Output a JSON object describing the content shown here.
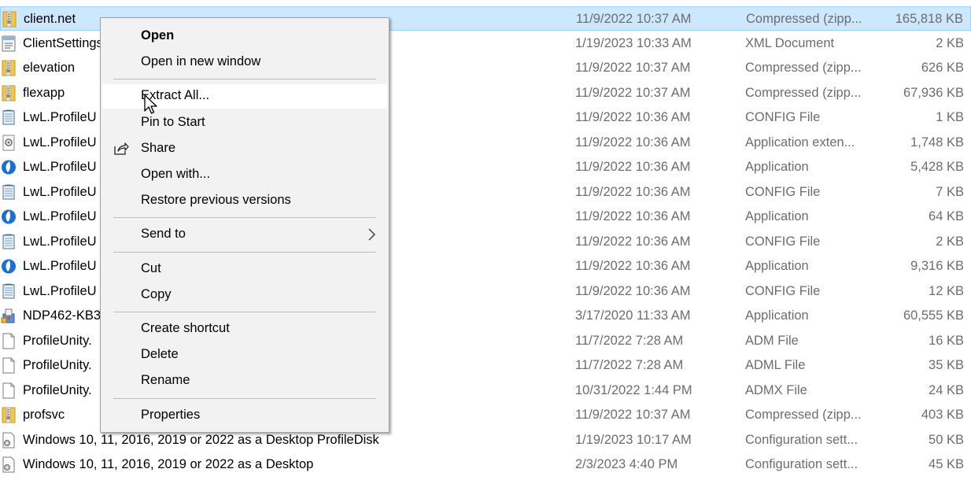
{
  "files": [
    {
      "name": "client.net",
      "date": "11/9/2022 10:37 AM",
      "type": "Compressed (zipp...",
      "size": "165,818 KB",
      "icon": "zip-folder-icon",
      "selected": true
    },
    {
      "name": "ClientSettings",
      "date": "1/19/2023 10:33 AM",
      "type": "XML Document",
      "size": "2 KB",
      "icon": "xml-document-icon"
    },
    {
      "name": "elevation",
      "date": "11/9/2022 10:37 AM",
      "type": "Compressed (zipp...",
      "size": "626 KB",
      "icon": "zip-folder-icon"
    },
    {
      "name": "flexapp",
      "date": "11/9/2022 10:37 AM",
      "type": "Compressed (zipp...",
      "size": "67,936 KB",
      "icon": "zip-folder-icon"
    },
    {
      "name": "LwL.ProfileU",
      "date": "11/9/2022 10:36 AM",
      "type": "CONFIG File",
      "size": "1 KB",
      "icon": "config-file-icon"
    },
    {
      "name": "LwL.ProfileU",
      "date": "11/9/2022 10:36 AM",
      "type": "Application exten...",
      "size": "1,748 KB",
      "icon": "dll-file-icon"
    },
    {
      "name": "LwL.ProfileU",
      "date": "11/9/2022 10:36 AM",
      "type": "Application",
      "size": "5,428 KB",
      "icon": "application-icon"
    },
    {
      "name": "LwL.ProfileU",
      "date": "11/9/2022 10:36 AM",
      "type": "CONFIG File",
      "size": "7 KB",
      "icon": "config-file-icon"
    },
    {
      "name": "LwL.ProfileU",
      "date": "11/9/2022 10:36 AM",
      "type": "Application",
      "size": "64 KB",
      "icon": "application-icon"
    },
    {
      "name": "LwL.ProfileU",
      "date": "11/9/2022 10:36 AM",
      "type": "CONFIG File",
      "size": "2 KB",
      "icon": "config-file-icon"
    },
    {
      "name": "LwL.ProfileU",
      "date": "11/9/2022 10:36 AM",
      "type": "Application",
      "size": "9,316 KB",
      "icon": "application-icon"
    },
    {
      "name": "LwL.ProfileU",
      "date": "11/9/2022 10:36 AM",
      "type": "CONFIG File",
      "size": "12 KB",
      "icon": "config-file-icon"
    },
    {
      "name": "NDP462-KB3",
      "date": "3/17/2020 11:33 AM",
      "type": "Application",
      "size": "60,555 KB",
      "icon": "installer-icon"
    },
    {
      "name": "ProfileUnity.",
      "date": "11/7/2022 7:28 AM",
      "type": "ADM File",
      "size": "16 KB",
      "icon": "blank-file-icon"
    },
    {
      "name": "ProfileUnity.",
      "date": "11/7/2022 7:28 AM",
      "type": "ADML File",
      "size": "35 KB",
      "icon": "blank-file-icon"
    },
    {
      "name": "ProfileUnity.",
      "date": "10/31/2022 1:44 PM",
      "type": "ADMX File",
      "size": "24 KB",
      "icon": "blank-file-icon"
    },
    {
      "name": "profsvc",
      "date": "11/9/2022 10:37 AM",
      "type": "Compressed (zipp...",
      "size": "403 KB",
      "icon": "zip-folder-icon"
    },
    {
      "name": "Windows 10, 11, 2016, 2019 or 2022 as a Desktop ProfileDisk",
      "date": "1/19/2023 10:17 AM",
      "type": "Configuration sett...",
      "size": "50 KB",
      "icon": "settings-file-icon"
    },
    {
      "name": "Windows 10, 11, 2016, 2019 or 2022 as a Desktop",
      "date": "2/3/2023 4:40 PM",
      "type": "Configuration sett...",
      "size": "45 KB",
      "icon": "settings-file-icon"
    }
  ],
  "context_menu": {
    "items": [
      {
        "label": "Open",
        "bold": true
      },
      {
        "label": "Open in new window"
      },
      {
        "separator": true
      },
      {
        "label": "Extract All...",
        "hover": true
      },
      {
        "label": "Pin to Start"
      },
      {
        "label": "Share",
        "icon": "share-icon"
      },
      {
        "label": "Open with..."
      },
      {
        "label": "Restore previous versions"
      },
      {
        "separator": true
      },
      {
        "label": "Send to",
        "submenu": true
      },
      {
        "separator": true
      },
      {
        "label": "Cut"
      },
      {
        "label": "Copy"
      },
      {
        "separator": true
      },
      {
        "label": "Create shortcut"
      },
      {
        "label": "Delete"
      },
      {
        "label": "Rename"
      },
      {
        "separator": true
      },
      {
        "label": "Properties"
      }
    ]
  },
  "colors": {
    "selection_bg": "#cce8ff",
    "selection_border": "#99d1ff",
    "menu_bg": "#f2f2f2",
    "menu_hover": "#ffffff",
    "detail_text": "#6d6d6d"
  }
}
